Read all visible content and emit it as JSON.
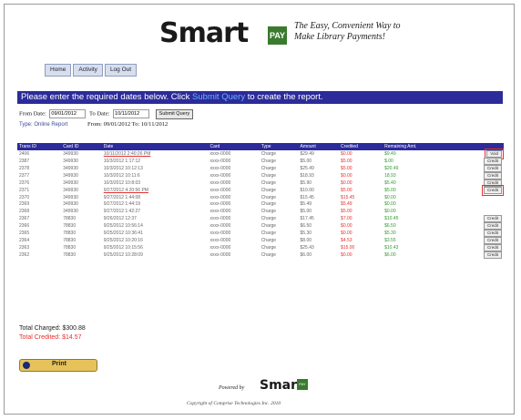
{
  "header": {
    "logo_main": "Smart",
    "logo_pay": "PAY",
    "logo_box": "PAY",
    "tagline": "The Easy, Convenient Way to Make Library Payments!"
  },
  "nav": [
    "Home",
    "Activity",
    "Log Out"
  ],
  "banner": {
    "before": "Please enter the required dates below. Click",
    "link": "Submit Query",
    "after": "to create the report."
  },
  "form": {
    "from_label": "From Date:",
    "from_value": "09/01/2012",
    "to_label": "To Date:",
    "to_value": "10/11/2012",
    "submit_label": "Submit Query"
  },
  "report": {
    "type": "Type: Online Report",
    "range": "From: 09/01/2012 To: 10/11/2012"
  },
  "table": {
    "headers": [
      "Trans ID",
      "Card ID",
      "Date",
      "Card",
      "Type",
      "Amount",
      "Credited",
      "Remaining Amt.",
      ""
    ],
    "rows": [
      [
        "2406",
        "349930",
        "10/11/2012 2:40:26 PM",
        "xxxx-0000",
        "Charge",
        "$29.49",
        "$0.00",
        "$9.49",
        "Void"
      ],
      [
        "2387",
        "349930",
        "10/3/2012 1:17:12",
        "xxxx-0000",
        "Charge",
        "$5.00",
        "$5.00",
        "$.00",
        "Credit"
      ],
      [
        "2378",
        "349930",
        "10/3/2012 10:12:13",
        "xxxx-0000",
        "Charge",
        "$25.49",
        "$5.00",
        "$20.49",
        "Credit"
      ],
      [
        "2377",
        "349930",
        "10/3/2012 10:11:6",
        "xxxx-0000",
        "Charge",
        "$18.93",
        "$0.00",
        "18.93",
        "Credit"
      ],
      [
        "2376",
        "349930",
        "10/3/2012 10:8:03",
        "xxxx-0000",
        "Charge",
        "$5.90",
        "$0.00",
        "$5.40",
        "Credit"
      ],
      [
        "2371",
        "349930",
        "9/27/2012 4:20:56 PM",
        "xxxx-0000",
        "Charge",
        "$10.00",
        "$5.00",
        "$5.00",
        "Credit"
      ],
      [
        "2370",
        "349930",
        "9/27/2012 1:44:08",
        "xxxx-0000",
        "Charge",
        "$15.45",
        "$15.45",
        "$0.00",
        ""
      ],
      [
        "2369",
        "349930",
        "9/27/2012 1:44:19",
        "xxxx-0000",
        "Charge",
        "$5.49",
        "$5.49",
        "$0.00",
        ""
      ],
      [
        "2368",
        "349930",
        "9/27/2012 1:42:27",
        "xxxx-0000",
        "Charge",
        "$5.00",
        "$5.00",
        "$0.00",
        ""
      ],
      [
        "2367",
        "78830",
        "9/26/2012 12:37",
        "xxxx-0000",
        "Charge",
        "$17.45",
        "$7.00",
        "$10.45",
        "Credit"
      ],
      [
        "2366",
        "78830",
        "9/25/2012 10:56:14",
        "xxxx-0000",
        "Charge",
        "$6.50",
        "$0.00",
        "$6.50",
        "Credit"
      ],
      [
        "2365",
        "78830",
        "9/25/2012 10:36:41",
        "xxxx-0000",
        "Charge",
        "$5.30",
        "$0.00",
        "$5.30",
        "Credit"
      ],
      [
        "2364",
        "78830",
        "9/25/2012 10:20:16",
        "xxxx-0000",
        "Charge",
        "$8.00",
        "$4.53",
        "$3.55",
        "Credit"
      ],
      [
        "2363",
        "78830",
        "9/25/2012 10:15:56",
        "xxxx-0000",
        "Charge",
        "$25.43",
        "$15.00",
        "$10.43",
        "Credit"
      ],
      [
        "2362",
        "78830",
        "9/25/2012 10:28:09",
        "xxxx-0000",
        "Charge",
        "$6.00",
        "$0.00",
        "$6.00",
        "Credit"
      ]
    ]
  },
  "totals": {
    "charged_label": "Total Charged:",
    "charged_value": "$300.88",
    "credited_label": "Total Credited:",
    "credited_value": "$14.57"
  },
  "print_label": "Print",
  "footer": {
    "powered_by": "Powered by",
    "logo": "Smart",
    "logo_box": "PAY",
    "copyright": "Copyright of Comprise Technologies Inc. 2010"
  }
}
